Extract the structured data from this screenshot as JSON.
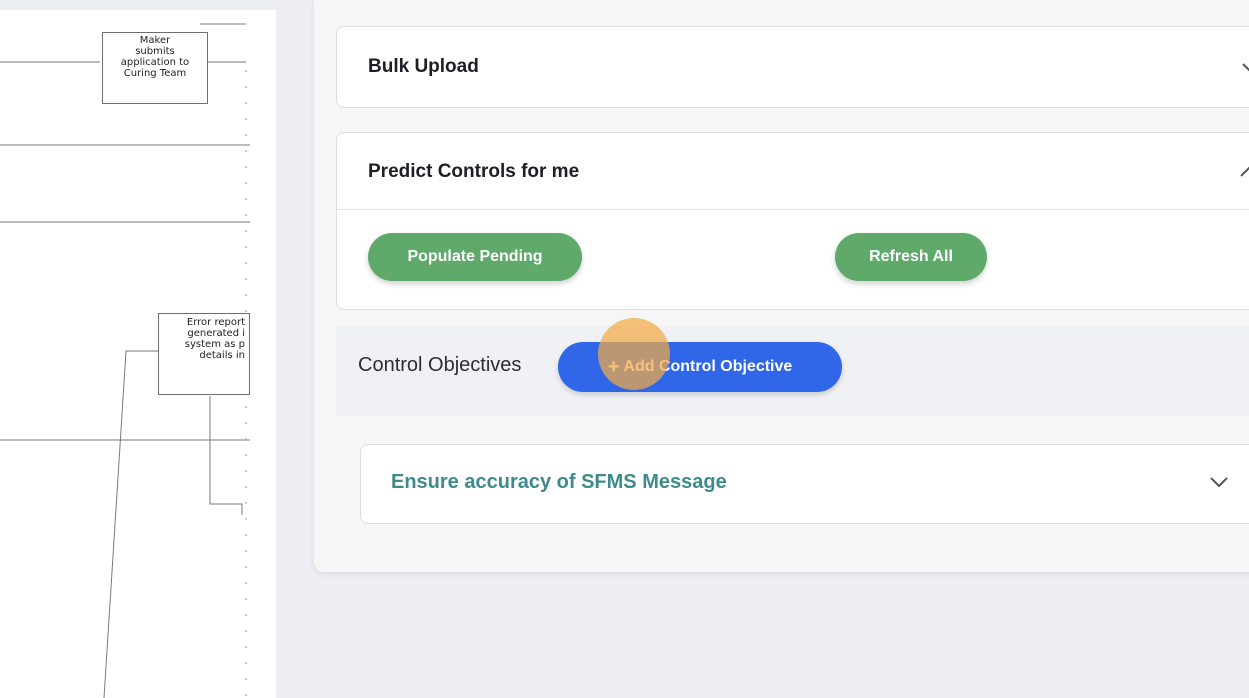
{
  "diagram": {
    "nodes": [
      {
        "id": "maker",
        "text": "Maker\nsubmits\napplication to\nCuring Team"
      },
      {
        "id": "error",
        "text": "Error report\ngenerated i\nsystem as p\ndetails in"
      }
    ]
  },
  "sections": {
    "bulk_upload": {
      "title": "Bulk Upload",
      "chevron_icon": "chevron-down-icon"
    },
    "predict_controls": {
      "title": "Predict Controls for me",
      "chevron_icon": "chevron-up-icon",
      "populate_pending_label": "Populate Pending",
      "refresh_all_label": "Refresh All",
      "button_color": "#5fa96a"
    }
  },
  "control_objectives": {
    "label": "Control Objectives",
    "add_button_plus": "+",
    "add_button_label": "Add Control Objective",
    "add_button_color": "#2f67e8",
    "items": [
      {
        "title": "Ensure accuracy of SFMS Message",
        "chevron_icon": "chevron-down-icon"
      }
    ]
  }
}
